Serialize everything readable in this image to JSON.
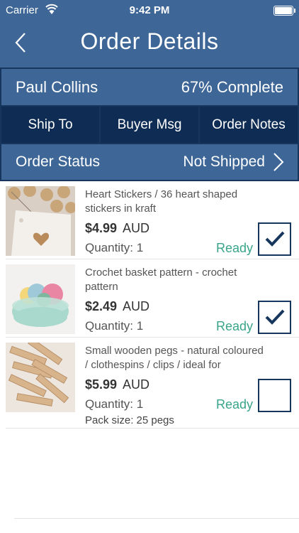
{
  "status_bar": {
    "carrier": "Carrier",
    "time": "9:42 PM"
  },
  "nav": {
    "title": "Order Details"
  },
  "summary": {
    "buyer": "Paul Collins",
    "completion": "67% Complete",
    "buttons": [
      "Ship To",
      "Buyer Msg",
      "Order Notes"
    ],
    "status_label": "Order Status",
    "status_value": "Not Shipped"
  },
  "items": [
    {
      "title": "Heart Stickers / 36 heart shaped stickers in kraft",
      "price": "$4.99",
      "currency": "AUD",
      "quantity": "Quantity: 1",
      "state": "Ready",
      "checked": true
    },
    {
      "title": "Crochet basket pattern - crochet pattern",
      "price": "$2.49",
      "currency": "AUD",
      "quantity": "Quantity: 1",
      "state": "Ready",
      "checked": true
    },
    {
      "title": "Small wooden pegs - natural coloured / clothespins / clips / ideal for",
      "price": "$5.99",
      "currency": "AUD",
      "quantity": "Quantity: 1",
      "pack_size": "Pack size: 25 pegs",
      "state": "Ready",
      "checked": false
    }
  ],
  "colors": {
    "nav": "#3e6798",
    "dark": "#0f2d54",
    "ready": "#39a48a"
  }
}
